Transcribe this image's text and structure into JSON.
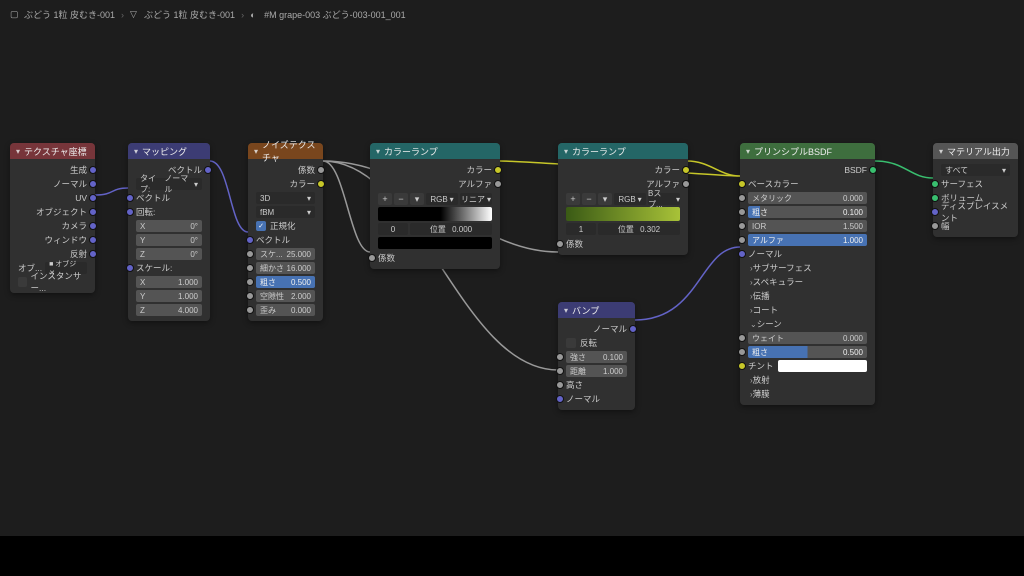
{
  "breadcrumb": {
    "a": "ぶどう 1粒 皮むき-001",
    "b": "ぶどう 1粒 皮むき-001",
    "c": "#M grape-003 ぶどう-003-001_001"
  },
  "texcoord": {
    "title": "テクスチャ座標",
    "outs": [
      "生成",
      "ノーマル",
      "UV",
      "オブジェクト",
      "カメラ",
      "ウィンドウ",
      "反射"
    ],
    "obj_label": "オブ...",
    "inst": "インスタンサー..."
  },
  "mapping": {
    "title": "マッピング",
    "out": "ベクトル",
    "type_label": "タイプ:",
    "type_value": "ノーマル",
    "vec_in": "ベクトル",
    "rot_hdr": "回転:",
    "rx": "X",
    "ry": "Y",
    "rz": "Z",
    "rxv": "0°",
    "ryv": "0°",
    "rzv": "0°",
    "scale_hdr": "スケール:",
    "sx": "X",
    "sy": "Y",
    "sz": "Z",
    "sxv": "1.000",
    "syv": "1.000",
    "szv": "4.000"
  },
  "noise": {
    "title": "ノイズテクスチャ",
    "out_fac": "係数",
    "out_color": "カラー",
    "dim": "3D",
    "type": "fBM",
    "normalize": "正規化",
    "vec": "ベクトル",
    "scale_l": "スケ...",
    "scale_v": "25.000",
    "detail_l": "細かさ",
    "detail_v": "16.000",
    "rough_l": "粗さ",
    "rough_v": "0.500",
    "lac_l": "空隙性",
    "lac_v": "2.000",
    "dist_l": "歪み",
    "dist_v": "0.000"
  },
  "ramp1": {
    "title": "カラーランプ",
    "out_color": "カラー",
    "out_alpha": "アルファ",
    "mode1": "RGB",
    "mode2": "リニア",
    "pos_l": "位置",
    "pos_v": "0.000",
    "idx": "0",
    "fac": "係数"
  },
  "ramp2": {
    "title": "カラーランプ",
    "out_color": "カラー",
    "out_alpha": "アルファ",
    "mode1": "RGB",
    "mode2": "Bスプ...",
    "pos_l": "位置",
    "pos_v": "0.302",
    "idx": "1",
    "fac": "係数"
  },
  "bump": {
    "title": "バンプ",
    "out": "ノーマル",
    "invert": "反転",
    "strength_l": "強さ",
    "strength_v": "0.100",
    "dist_l": "距離",
    "dist_v": "1.000",
    "height": "高さ",
    "normal": "ノーマル"
  },
  "bsdf": {
    "title": "プリンシプルBSDF",
    "out": "BSDF",
    "base": "ベースカラー",
    "metal_l": "メタリック",
    "metal_v": "0.000",
    "rough_l": "粗さ",
    "rough_v": "0.100",
    "ior_l": "IOR",
    "ior_v": "1.500",
    "alpha_l": "アルファ",
    "alpha_v": "1.000",
    "normal": "ノーマル",
    "subsurf": "サブサーフェス",
    "spec": "スペキュラー",
    "trans": "伝播",
    "coat": "コート",
    "sheen": "シーン",
    "weight_l": "ウェイト",
    "weight_v": "0.000",
    "srough_l": "粗さ",
    "srough_v": "0.500",
    "tint": "チント",
    "emit": "放射",
    "thin": "薄膜"
  },
  "output": {
    "title": "マテリアル出力",
    "target": "すべて",
    "surface": "サーフェス",
    "volume": "ボリューム",
    "disp": "ディスプレイスメント",
    "thick": "幅"
  }
}
